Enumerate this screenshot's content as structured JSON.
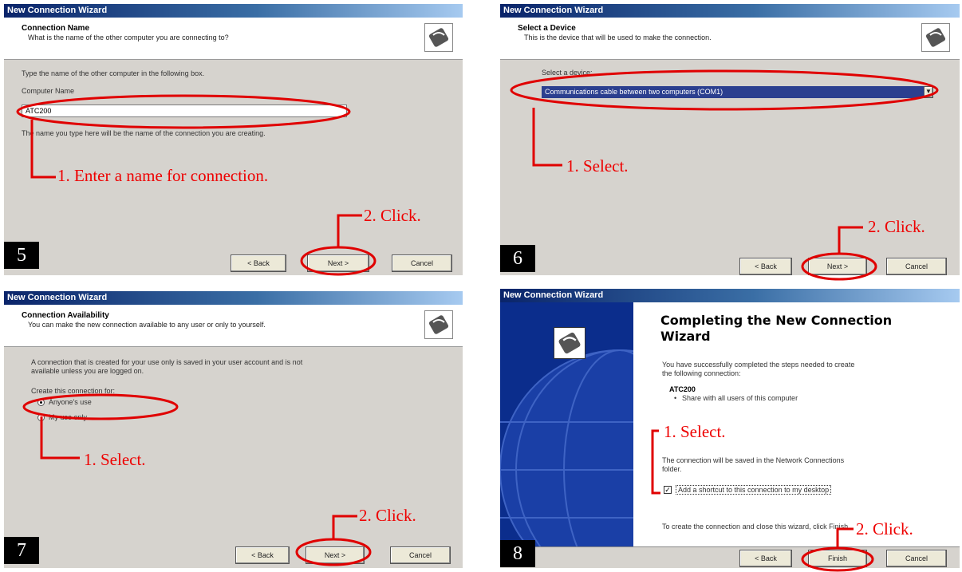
{
  "colors": {
    "annotation": "#e00000",
    "dialog_bg": "#d6d3ce",
    "titlebar": "#0a246a",
    "selection": "#2b3f8f"
  },
  "icons": {
    "wizard": "phone-connection-icon",
    "globe": "globe-icon"
  },
  "panels": {
    "p5": {
      "window_title": "New Connection Wizard",
      "header_title": "Connection Name",
      "header_sub": "What is the name of the other computer you are connecting to?",
      "instruction": "Type the name of the other computer in the following box.",
      "field_label": "Computer Name",
      "field_value": "ATC200",
      "hint": "The name you type here will be the name of the connection you are creating.",
      "back": "< Back",
      "next": "Next >",
      "cancel": "Cancel",
      "step": "5",
      "callout1": "1. Enter a name for connection.",
      "callout2": "2. Click."
    },
    "p6": {
      "window_title": "New Connection Wizard",
      "header_title": "Select a Device",
      "header_sub": "This is the device that will be used to make the connection.",
      "field_label": "Select a device:",
      "selected": "Communications cable between two computers (COM1)",
      "back": "< Back",
      "next": "Next >",
      "cancel": "Cancel",
      "step": "6",
      "callout1": "1. Select.",
      "callout2": "2. Click."
    },
    "p7": {
      "window_title": "New Connection Wizard",
      "header_title": "Connection Availability",
      "header_sub": "You can make the new connection available to any user or only to yourself.",
      "info1": "A connection that is created for your use only is saved in your user account and is not",
      "info2": "available unless you are logged on.",
      "group_label": "Create this connection for:",
      "opt1": "Anyone's use",
      "opt2": "My use only",
      "back": "< Back",
      "next": "Next >",
      "cancel": "Cancel",
      "step": "7",
      "callout1": "1. Select.",
      "callout2": "2. Click."
    },
    "p8": {
      "window_title": "New Connection Wizard",
      "heading1": "Completing the New Connection",
      "heading2": "Wizard",
      "success1": "You have successfully completed the steps needed to create",
      "success2": "the following connection:",
      "conn_name": "ATC200",
      "bullet": "Share with all users of this computer",
      "saved1": "The connection will be saved in the Network Connections",
      "saved2": "folder.",
      "shortcut": "Add a shortcut to this connection to my desktop",
      "finish_hint": "To create the connection and close this wizard, click Finish.",
      "back": "< Back",
      "finish": "Finish",
      "cancel": "Cancel",
      "step": "8",
      "callout1": "1. Select.",
      "callout2": "2. Click."
    }
  }
}
